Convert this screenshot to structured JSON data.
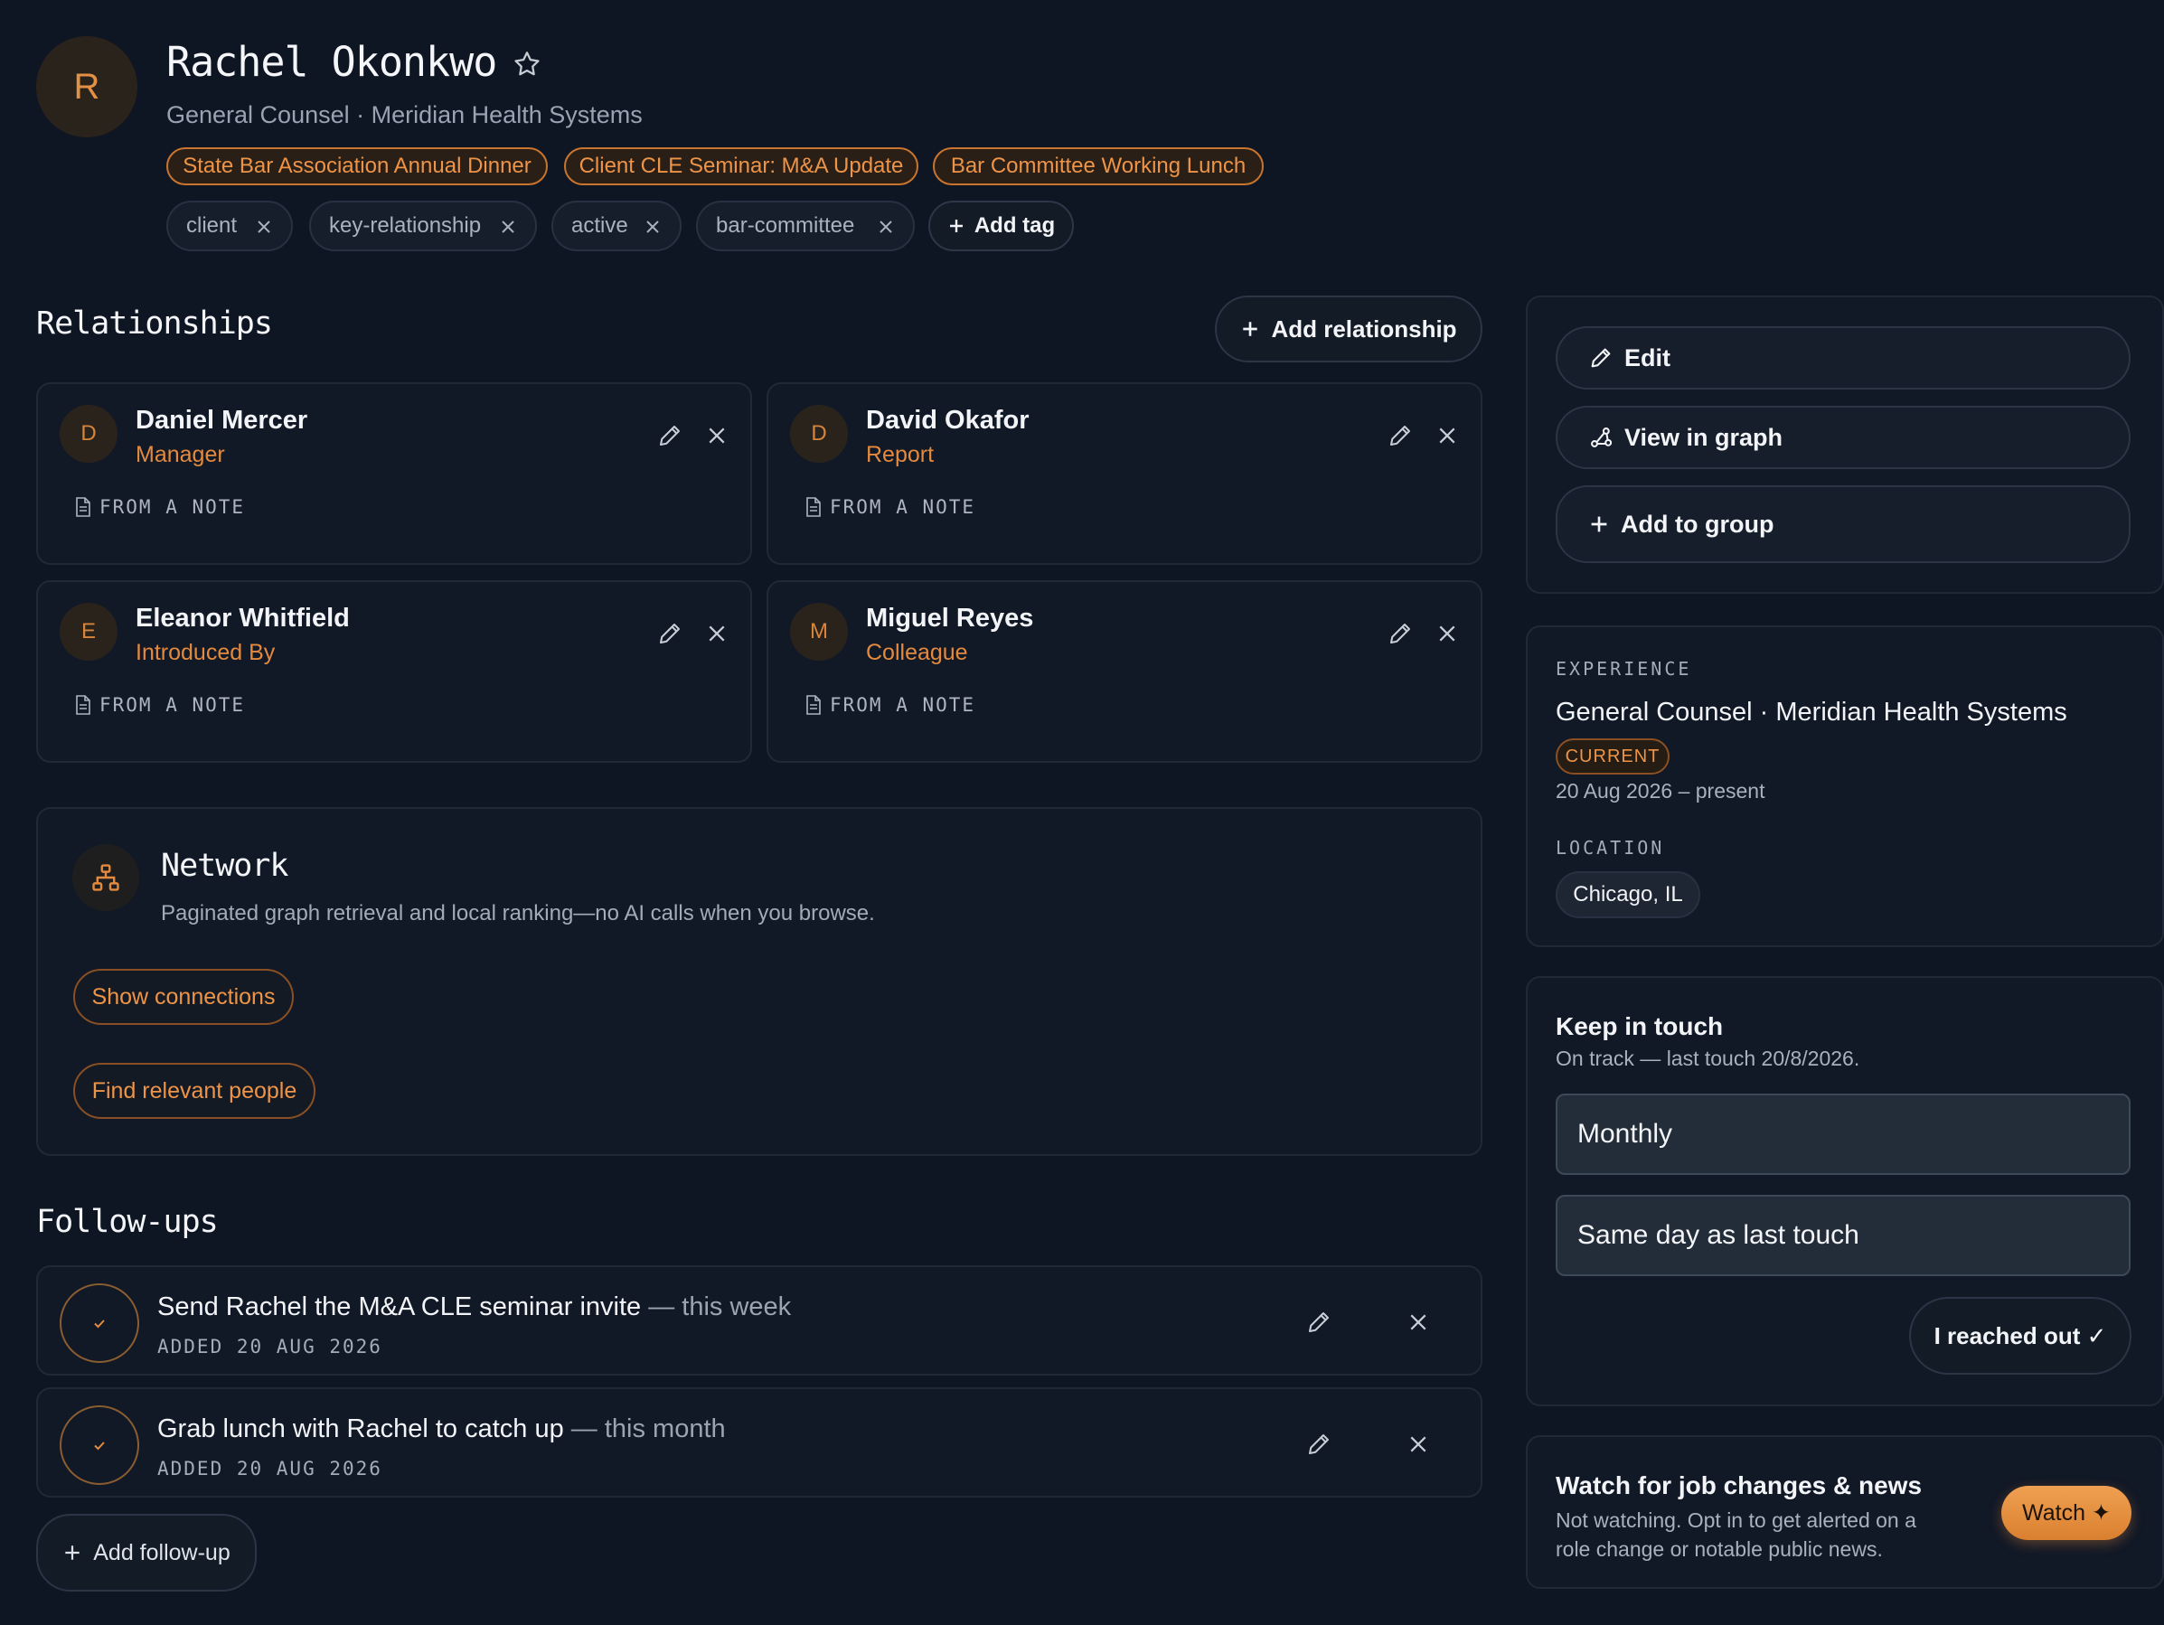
{
  "profile": {
    "initial": "R",
    "name": "Rachel Okonkwo",
    "subtitle": "General Counsel · Meridian Health Systems"
  },
  "events": [
    "State Bar Association Annual Dinner",
    "Client CLE Seminar: M&A Update",
    "Bar Committee Working Lunch"
  ],
  "tags": [
    "client",
    "key-relationship",
    "active",
    "bar-committee"
  ],
  "add_tag_label": "Add tag",
  "relationships": {
    "title": "Relationships",
    "add_label": "Add relationship",
    "note_label": "FROM A NOTE",
    "items": [
      {
        "initial": "D",
        "name": "Daniel Mercer",
        "role": "Manager"
      },
      {
        "initial": "D",
        "name": "David Okafor",
        "role": "Report"
      },
      {
        "initial": "E",
        "name": "Eleanor Whitfield",
        "role": "Introduced By"
      },
      {
        "initial": "M",
        "name": "Miguel Reyes",
        "role": "Colleague"
      }
    ]
  },
  "network": {
    "title": "Network",
    "description": "Paginated graph retrieval and local ranking—no AI calls when you browse.",
    "show_connections": "Show connections",
    "find_people": "Find relevant people"
  },
  "followups": {
    "title": "Follow-ups",
    "items": [
      {
        "text": "Send Rachel the M&A CLE seminar invite",
        "when": " — this week",
        "added": "ADDED 20 AUG 2026"
      },
      {
        "text": "Grab lunch with Rachel to catch up",
        "when": " — this month",
        "added": "ADDED 20 AUG 2026"
      }
    ],
    "add_label": "Add follow-up"
  },
  "actions": {
    "edit": "Edit",
    "view_graph": "View in graph",
    "add_group": "Add to group"
  },
  "experience": {
    "label": "EXPERIENCE",
    "role": "General Counsel · Meridian Health Systems",
    "badge": "CURRENT",
    "dates": "20 Aug 2026 – present",
    "location_label": "LOCATION",
    "location": "Chicago, IL"
  },
  "keep_in_touch": {
    "title": "Keep in touch",
    "status": "On track — last touch 20/8/2026.",
    "frequency": "Monthly",
    "schedule": "Same day as last touch",
    "reached_out": "I reached out ✓"
  },
  "watch": {
    "title": "Watch for job changes & news",
    "description_line1": "Not watching. Opt in to get alerted on a",
    "description_line2": "role change or notable public news.",
    "button": "Watch ✦"
  },
  "colors": {
    "background": "#0f1623",
    "accent": "#e8883a",
    "card": "#111826"
  }
}
